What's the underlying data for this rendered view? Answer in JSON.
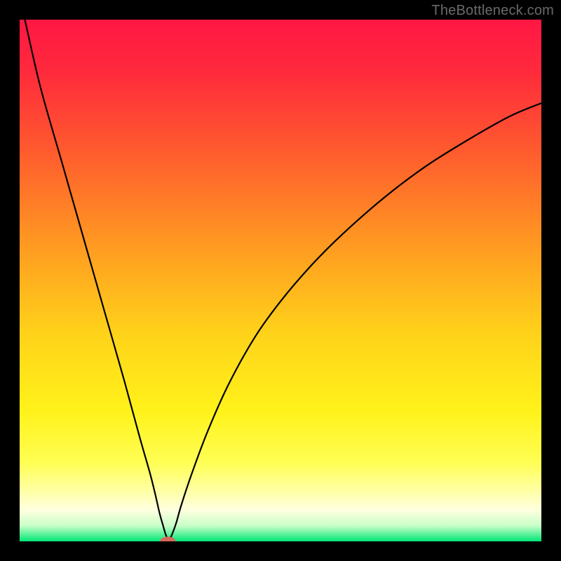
{
  "watermark": "TheBottleneck.com",
  "chart_data": {
    "type": "line",
    "title": "",
    "xlabel": "",
    "ylabel": "",
    "x_range": [
      0,
      100
    ],
    "y_range": [
      0,
      100
    ],
    "background_gradient_stops": [
      {
        "offset": 0.0,
        "color": "#ff1744"
      },
      {
        "offset": 0.1,
        "color": "#ff2a3c"
      },
      {
        "offset": 0.25,
        "color": "#ff5a2e"
      },
      {
        "offset": 0.45,
        "color": "#ffa020"
      },
      {
        "offset": 0.6,
        "color": "#ffd21a"
      },
      {
        "offset": 0.75,
        "color": "#fff21a"
      },
      {
        "offset": 0.85,
        "color": "#ffff55"
      },
      {
        "offset": 0.9,
        "color": "#ffffa0"
      },
      {
        "offset": 0.94,
        "color": "#ffffe0"
      },
      {
        "offset": 0.97,
        "color": "#c8ffc8"
      },
      {
        "offset": 1.0,
        "color": "#00e676"
      }
    ],
    "series": [
      {
        "name": "bottleneck-curve",
        "type": "line",
        "color": "#000000",
        "x": [
          1.0,
          4,
          8,
          12,
          16,
          20,
          23,
          25,
          26,
          26.8,
          27.5,
          28,
          28.4,
          28.8,
          29.2,
          30,
          31,
          33,
          36,
          40,
          45,
          50,
          56,
          62,
          70,
          78,
          86,
          94,
          100
        ],
        "y": [
          100,
          87,
          73,
          59,
          45,
          31,
          20,
          13,
          9,
          5.5,
          3.0,
          1.3,
          0.6,
          0.6,
          1.3,
          3.5,
          7,
          13,
          21,
          30,
          39,
          46,
          53,
          59,
          66,
          72,
          77,
          81.5,
          84
        ]
      }
    ],
    "marker": {
      "name": "optimal-marker",
      "x": 28.4,
      "y": 0.0,
      "rx": 1.5,
      "ry": 0.9,
      "color": "#d46a5a"
    }
  }
}
